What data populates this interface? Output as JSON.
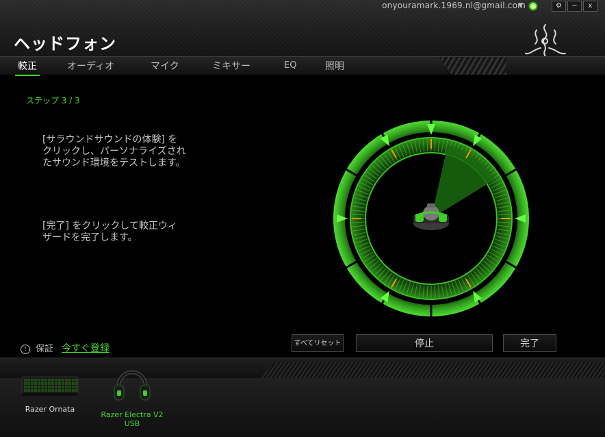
{
  "header": {
    "account_email": "onyouramark.1969.nl@gmail.com",
    "title": "ヘッドフォン",
    "window_buttons": [
      "⚙",
      "−",
      "x"
    ]
  },
  "tabs": [
    {
      "label": "較正",
      "active": true
    },
    {
      "label": "オーディオ",
      "active": false
    },
    {
      "label": "マイク",
      "active": false
    },
    {
      "label": "ミキサー",
      "active": false
    },
    {
      "label": "EQ",
      "active": false
    },
    {
      "label": "照明",
      "active": false
    }
  ],
  "content": {
    "step": "ステップ 3 / 3",
    "instruction_1": [
      "[サラウンドサウンドの体験] を",
      "クリックし、パーソナライズされ",
      "たサウンド環境をテストします。"
    ],
    "instruction_2": [
      "[完了] をクリックして較正ウィ",
      "ザードを完了します。"
    ]
  },
  "warranty": {
    "label": "保証",
    "link": "今すぐ登録"
  },
  "buttons": {
    "reset_all": "すべてリセット",
    "stop": "停止",
    "done": "完了"
  },
  "devices": [
    {
      "name": "Razer Ornata",
      "active": false,
      "icon": "keyboard-icon"
    },
    {
      "name": "Razer Electra V2 USB",
      "active": true,
      "icon": "headset-icon"
    }
  ],
  "colors": {
    "accent": "#44d62c",
    "background": "#000000",
    "marker": "#ff9900"
  }
}
